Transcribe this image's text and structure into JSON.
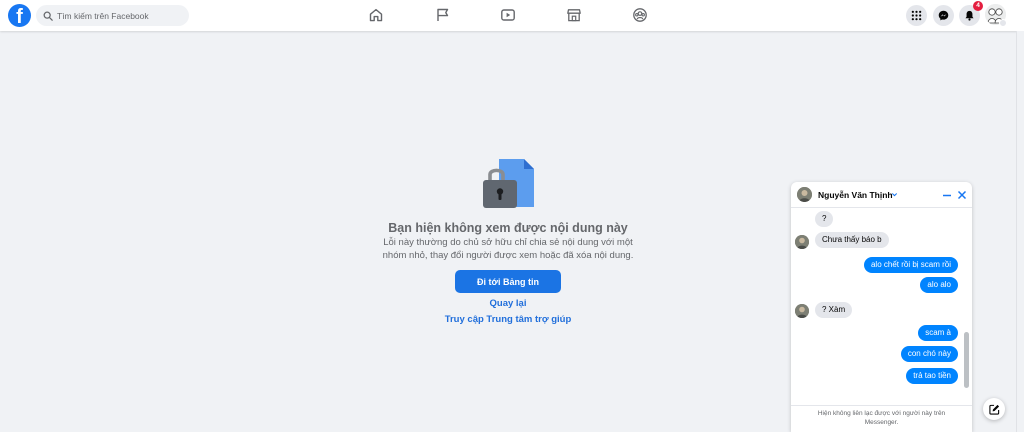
{
  "header": {
    "search_placeholder": "Tìm kiếm trên Facebook",
    "logo_letter": "f",
    "notification_count": "4",
    "nav": [
      "home-icon",
      "flag-icon",
      "watch-icon",
      "marketplace-icon",
      "groups-icon"
    ]
  },
  "content": {
    "title": "Bạn hiện không xem được nội dung này",
    "description_line1": "Lỗi này thường do chủ sở hữu chỉ chia sẻ nội dung với một",
    "description_line2": "nhóm nhỏ, thay đổi người được xem hoặc đã xóa nội dung.",
    "primary_button": "Đi tới Bảng tin",
    "back_link": "Quay lại",
    "help_link": "Truy cập Trung tâm trợ giúp"
  },
  "chat": {
    "name": "Nguyễn Văn Thịnh",
    "messages": [
      {
        "from": "them",
        "text": "?"
      },
      {
        "from": "them",
        "text": "Chưa thấy báo b"
      },
      {
        "from": "me",
        "text": "alo chết rồi bị scam rồi"
      },
      {
        "from": "me",
        "text": "alo alo"
      },
      {
        "from": "them",
        "text": "? Xàm"
      },
      {
        "from": "me",
        "text": "scam à"
      },
      {
        "from": "me",
        "text": "con chó này"
      },
      {
        "from": "me",
        "text": "trả tao tiền"
      }
    ],
    "footer_line1": "Hiện không liên lạc được với người này trên",
    "footer_line2": "Messenger."
  },
  "colors": {
    "brand": "#1877f2",
    "outgoing_bubble": "#0084ff",
    "incoming_bubble": "#e4e6eb",
    "badge": "#e41e3f"
  }
}
